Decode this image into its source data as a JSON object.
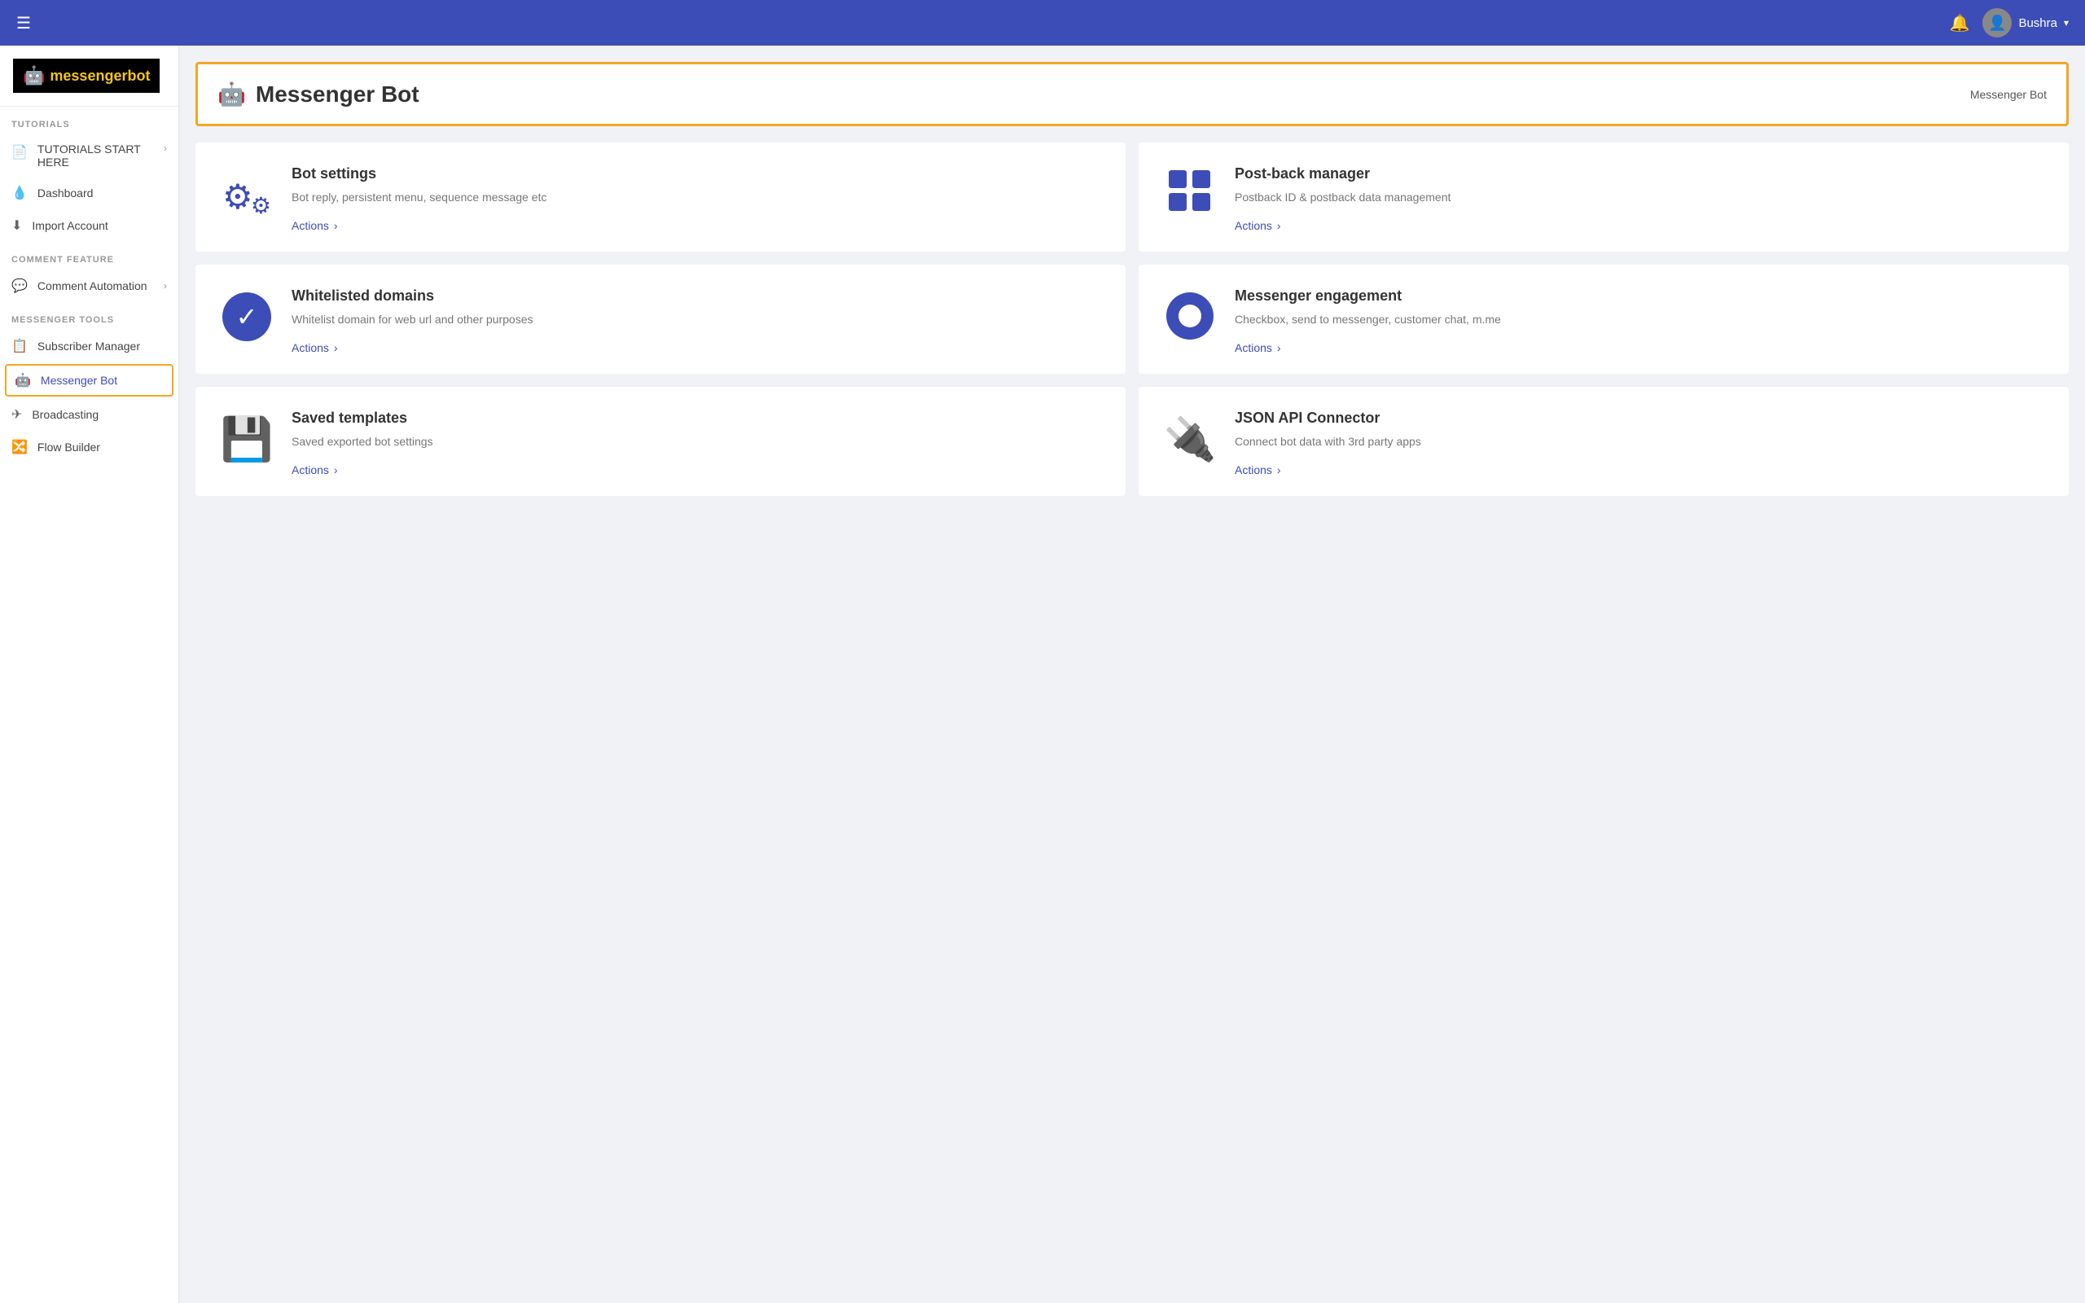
{
  "header": {
    "hamburger_label": "☰",
    "notification_icon": "🔔",
    "user_name": "Bushra",
    "dropdown_arrow": "▾",
    "user_avatar": "👤"
  },
  "sidebar": {
    "logo_text_main": "messenger",
    "logo_text_accent": "bot",
    "sections": [
      {
        "label": "TUTORIALS",
        "items": [
          {
            "id": "tutorials-start",
            "label": "TUTORIALS START HERE",
            "icon": "📄",
            "has_arrow": true
          },
          {
            "id": "dashboard",
            "label": "Dashboard",
            "icon": "💧",
            "has_arrow": false
          },
          {
            "id": "import-account",
            "label": "Import Account",
            "icon": "⬇",
            "has_arrow": false
          }
        ]
      },
      {
        "label": "COMMENT FEATURE",
        "items": [
          {
            "id": "comment-automation",
            "label": "Comment Automation",
            "icon": "💬",
            "has_arrow": true
          }
        ]
      },
      {
        "label": "MESSENGER TOOLS",
        "items": [
          {
            "id": "subscriber-manager",
            "label": "Subscriber Manager",
            "icon": "📋",
            "has_arrow": false
          },
          {
            "id": "messenger-bot",
            "label": "Messenger Bot",
            "icon": "🤖",
            "has_arrow": false,
            "active": true
          },
          {
            "id": "broadcasting",
            "label": "Broadcasting",
            "icon": "✈",
            "has_arrow": false
          },
          {
            "id": "flow-builder",
            "label": "Flow Builder",
            "icon": "🔀",
            "has_arrow": false
          }
        ]
      }
    ]
  },
  "page": {
    "title": "Messenger Bot",
    "breadcrumb": "Messenger Bot",
    "cards": [
      {
        "id": "bot-settings",
        "title": "Bot settings",
        "desc": "Bot reply, persistent menu, sequence message etc",
        "action": "Actions",
        "icon_type": "gears"
      },
      {
        "id": "postback-manager",
        "title": "Post-back manager",
        "desc": "Postback ID & postback data management",
        "action": "Actions",
        "icon_type": "grid"
      },
      {
        "id": "whitelisted-domains",
        "title": "Whitelisted domains",
        "desc": "Whitelist domain for web url and other purposes",
        "action": "Actions",
        "icon_type": "check"
      },
      {
        "id": "messenger-engagement",
        "title": "Messenger engagement",
        "desc": "Checkbox, send to messenger, customer chat, m.me",
        "action": "Actions",
        "icon_type": "ring"
      },
      {
        "id": "saved-templates",
        "title": "Saved templates",
        "desc": "Saved exported bot settings",
        "action": "Actions",
        "icon_type": "save"
      },
      {
        "id": "json-api-connector",
        "title": "JSON API Connector",
        "desc": "Connect bot data with 3rd party apps",
        "action": "Actions",
        "icon_type": "plug"
      }
    ]
  }
}
